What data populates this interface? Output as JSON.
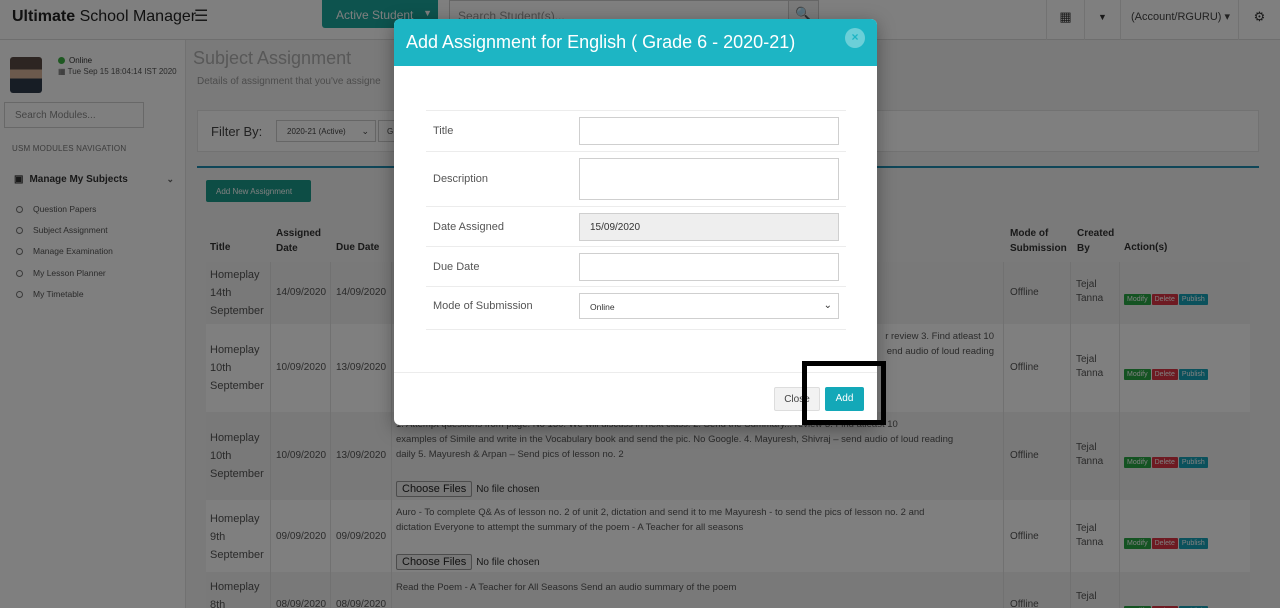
{
  "app": {
    "brand_bold": "Ultimate",
    "brand_rest": " School Manager"
  },
  "topbar": {
    "active_student_label": "Active Student",
    "search_placeholder": "Search Student(s)...",
    "account_label": "(Account/RGURU)"
  },
  "sidebar": {
    "status": "Online",
    "datetime": "Tue Sep 15 18:04:14 IST 2020",
    "search_placeholder": "Search Modules...",
    "nav_heading": "USM MODULES NAVIGATION",
    "main_item": "Manage My Subjects",
    "items": [
      "Question Papers",
      "Subject Assignment",
      "Manage Examination",
      "My Lesson Planner",
      "My Timetable"
    ]
  },
  "main": {
    "page_title": "Subject Assignment",
    "page_subtitle": "Details of assignment that you've assigne",
    "filter_label": "Filter By:",
    "filter_year": "2020-21 (Active)",
    "filter_second": "G",
    "add_new_label": "Add New Assignment",
    "columns": {
      "title": "Title",
      "assigned_date": "Assigned Date",
      "due_date": "Due Date",
      "mode": "Mode of Submission",
      "created_by": "Created By",
      "actions": "Action(s)"
    },
    "choose_files": "Choose Files",
    "no_file": "No file chosen",
    "btn_modify": "Modify",
    "btn_delete": "Delete",
    "btn_publish": "Publish",
    "rows": [
      {
        "title": "Homeplay 14th September",
        "assigned": "14/09/2020",
        "due": "14/09/2020",
        "desc_lines": [],
        "mode": "Offline",
        "created": "Tejal Tanna"
      },
      {
        "title": "Homeplay 10th September",
        "assigned": "10/09/2020",
        "due": "13/09/2020",
        "desc_lines": [
          "r review 3. Find atleast 10",
          "end audio of loud reading"
        ],
        "mode": "Offline",
        "created": "Tejal Tanna"
      },
      {
        "title": "Homeplay 10th September",
        "assigned": "10/09/2020",
        "due": "13/09/2020",
        "desc_lines": [
          "1. Attempt questions from page. No 130. We will discuss in next class. 2. Send the Summary... review 3. Find atleast 10",
          "examples of Simile and write in the Vocabulary book and send the pic. No Google. 4. Mayuresh, Shivraj – send audio of loud reading",
          "daily 5. Mayuresh & Arpan – Send pics of lesson no. 2"
        ],
        "mode": "Offline",
        "created": "Tejal Tanna"
      },
      {
        "title": "Homeplay 9th September",
        "assigned": "09/09/2020",
        "due": "09/09/2020",
        "desc_lines": [
          "Auro - To complete Q& As of lesson no. 2 of unit 2, dictation and send it to me Mayuresh - to send the pics of lesson no. 2 and",
          "dictation Everyone to attempt the summary of the poem - A Teacher for all seasons"
        ],
        "mode": "Offline",
        "created": "Tejal Tanna"
      },
      {
        "title": "Homeplay 8th",
        "assigned": "08/09/2020",
        "due": "08/09/2020",
        "desc_lines": [
          "Read the Poem - A Teacher for All Seasons Send an audio summary of the poem"
        ],
        "mode": "Offline",
        "created": "Tejal"
      }
    ]
  },
  "modal": {
    "title": "Add Assignment for English ( Grade 6 - 2020-21)",
    "close_x": "×",
    "fields": {
      "title_label": "Title",
      "title_value": "",
      "description_label": "Description",
      "description_value": "",
      "date_assigned_label": "Date Assigned",
      "date_assigned_value": "15/09/2020",
      "due_date_label": "Due Date",
      "due_date_value": "",
      "mode_label": "Mode of Submission",
      "mode_value": "Online"
    },
    "close_button": "Close",
    "add_button": "Add"
  },
  "colors": {
    "modal_header": "#1db5c4",
    "add_button": "#13a8b8",
    "teal_button": "#1a9b8a",
    "active_student": "#1aa79c",
    "modify": "#28a745",
    "delete": "#dc3545",
    "publish": "#17a2b8"
  },
  "icons": [
    "hamburger-icon",
    "search-icon",
    "grid-icon",
    "caret-down-icon",
    "settings-icon",
    "calendar-icon",
    "briefcase-icon",
    "chevron-down-icon",
    "circle-icon",
    "close-icon"
  ]
}
